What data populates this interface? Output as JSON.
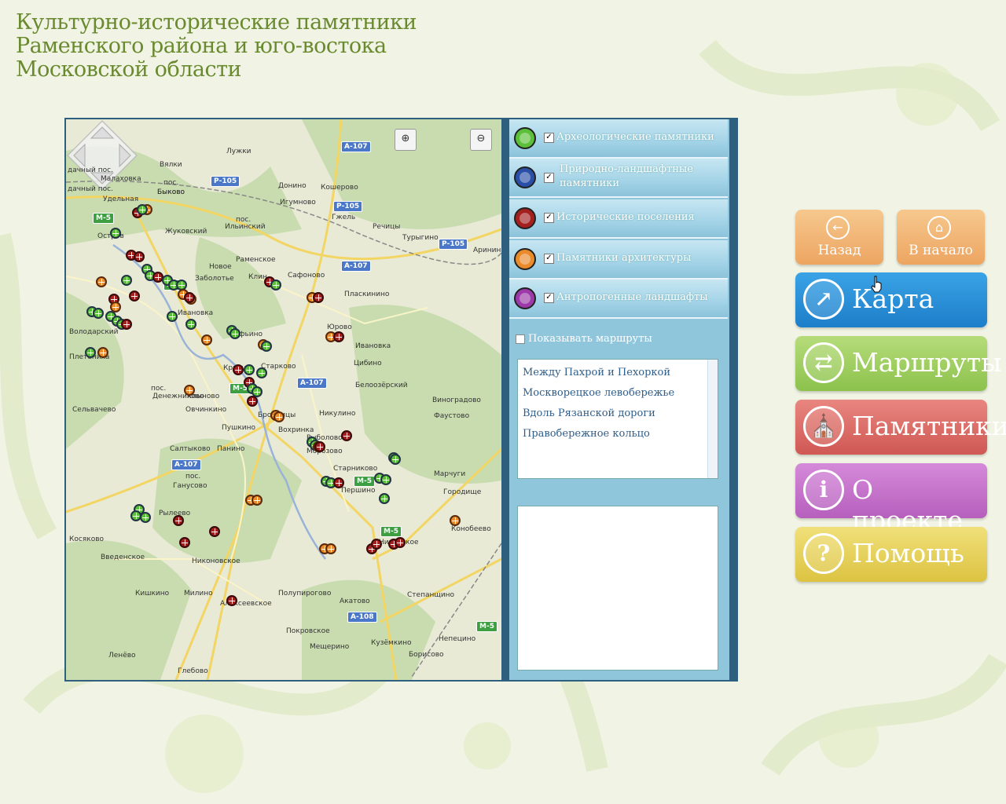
{
  "title": {
    "line1": "Культурно-исторические памятники",
    "line2": "Раменского района и юго-востока",
    "line3": "Московской области"
  },
  "map": {
    "places": [
      {
        "label": "Лужки"
      },
      {
        "label": "Вялки"
      },
      {
        "label": "дачный пос."
      },
      {
        "label": "Малаховка"
      },
      {
        "label": "дачный пос."
      },
      {
        "label": "Удельная"
      },
      {
        "label": "Быково"
      },
      {
        "label": "пос."
      },
      {
        "label": "Быково"
      },
      {
        "label": "Донино"
      },
      {
        "label": "Кошерово"
      },
      {
        "label": "Игумново"
      },
      {
        "label": "Гжель"
      },
      {
        "label": "пос."
      },
      {
        "label": "Ильинский"
      },
      {
        "label": "Жуковский"
      },
      {
        "label": "Речицы"
      },
      {
        "label": "Турыгино"
      },
      {
        "label": "Остров"
      },
      {
        "label": "Раменское"
      },
      {
        "label": "Новое"
      },
      {
        "label": "Заболотье"
      },
      {
        "label": "Клин"
      },
      {
        "label": "Сафоново"
      },
      {
        "label": "Аринин"
      },
      {
        "label": "Пласкинино"
      },
      {
        "label": "Ивановка"
      },
      {
        "label": "Софьино"
      },
      {
        "label": "Юрово"
      },
      {
        "label": "Ивановка"
      },
      {
        "label": "Володарский"
      },
      {
        "label": "Цибино"
      },
      {
        "label": "Плетениха"
      },
      {
        "label": "Кривцы"
      },
      {
        "label": "Старково"
      },
      {
        "label": "Белоозёрский"
      },
      {
        "label": "пос."
      },
      {
        "label": "Денежниково"
      },
      {
        "label": "Хлыново"
      },
      {
        "label": "Виноградово"
      },
      {
        "label": "Сельвачево"
      },
      {
        "label": "Овчинкино"
      },
      {
        "label": "Никулино"
      },
      {
        "label": "Фаустово"
      },
      {
        "label": "Бронницы"
      },
      {
        "label": "Пушкино"
      },
      {
        "label": "Вохринка"
      },
      {
        "label": "Рыболово"
      },
      {
        "label": "Салтыково"
      },
      {
        "label": "Панино"
      },
      {
        "label": "Морозово"
      },
      {
        "label": "Старниково"
      },
      {
        "label": "Марчуги"
      },
      {
        "label": "пос."
      },
      {
        "label": "Ганусово"
      },
      {
        "label": "Першино"
      },
      {
        "label": "Городище"
      },
      {
        "label": "Рылеево"
      },
      {
        "label": "Косяково"
      },
      {
        "label": "Конобеево"
      },
      {
        "label": "Введенское"
      },
      {
        "label": "Никоновское"
      },
      {
        "label": "Никитское"
      },
      {
        "label": "Кишкино"
      },
      {
        "label": "Милино"
      },
      {
        "label": "Алексеевское"
      },
      {
        "label": "Полупирогово"
      },
      {
        "label": "Акатово"
      },
      {
        "label": "Степанщино"
      },
      {
        "label": "Покровское"
      },
      {
        "label": "Мещерино"
      },
      {
        "label": "Кузёмкино"
      },
      {
        "label": "Непецино"
      },
      {
        "label": "Ленёво"
      },
      {
        "label": "Борисово"
      },
      {
        "label": "Глебово"
      }
    ],
    "shields": [
      {
        "label": "А-107",
        "type": "blue"
      },
      {
        "label": "Р-105",
        "type": "blue"
      },
      {
        "label": "Р-105",
        "type": "blue"
      },
      {
        "label": "Р-105",
        "type": "blue"
      },
      {
        "label": "А-107",
        "type": "blue"
      },
      {
        "label": "А-107",
        "type": "blue"
      },
      {
        "label": "А-107",
        "type": "blue"
      },
      {
        "label": "А-108",
        "type": "blue"
      },
      {
        "label": "М-5",
        "type": "green"
      },
      {
        "label": "М-5",
        "type": "green"
      },
      {
        "label": "М-5",
        "type": "green"
      },
      {
        "label": "М-5",
        "type": "green"
      },
      {
        "label": "М-5",
        "type": "green"
      },
      {
        "label": "М-5",
        "type": "green"
      }
    ],
    "zoom_in_icon": "zoom-in-icon",
    "zoom_out_icon": "zoom-out-icon"
  },
  "layers": [
    {
      "label": "Археологические памятники",
      "color": "#5bbf3a",
      "checked": true
    },
    {
      "label": "Природно-ландшафтные памятники",
      "color": "#2a4fa6",
      "checked": true
    },
    {
      "label": "Исторические поселения",
      "color": "#a3201f",
      "checked": true
    },
    {
      "label": "Памятники архитектуры",
      "color": "#e98a2b",
      "checked": true
    },
    {
      "label": "Антропогенные ландшафты",
      "color": "#9b3aa8",
      "checked": true
    }
  ],
  "routes": {
    "toggle_label": "Показывать маршруты",
    "items": [
      "Между Пахрой и Пехоркой",
      "Москворецкое левобережье",
      "Вдоль Рязанской дороги",
      "Правобережное кольцо"
    ]
  },
  "nav": {
    "back_label": "Назад",
    "home_label": "В начало",
    "buttons": [
      {
        "label": "Карта",
        "icon": "compass-icon",
        "color_top": "#3aa3e6",
        "color_bottom": "#1d7ec9"
      },
      {
        "label": "Маршруты",
        "icon": "routes-icon",
        "color_top": "#b6dc7a",
        "color_bottom": "#8cc24c"
      },
      {
        "label": "Памятники",
        "icon": "church-icon",
        "color_top": "#e98680",
        "color_bottom": "#cf5853"
      },
      {
        "label": "О проекте",
        "icon": "info-icon",
        "color_top": "#d58ad9",
        "color_bottom": "#b65fbd"
      },
      {
        "label": "Помощь",
        "icon": "help-icon",
        "color_top": "#f0e07a",
        "color_bottom": "#dcc341"
      }
    ]
  }
}
